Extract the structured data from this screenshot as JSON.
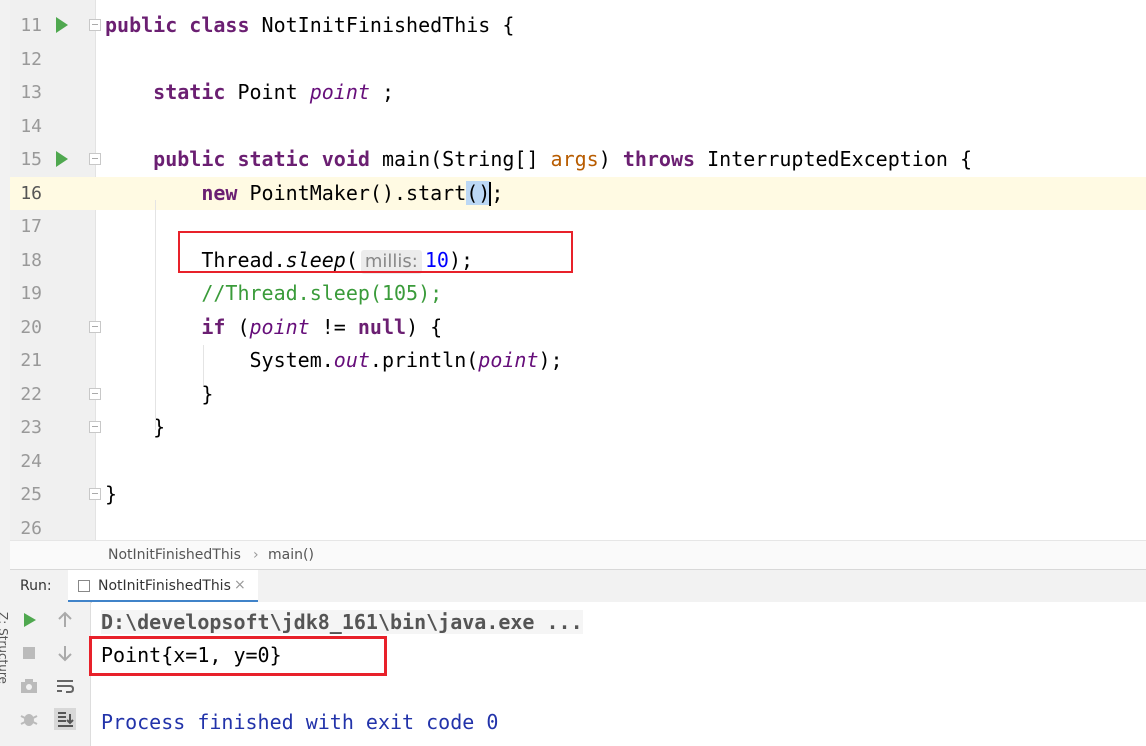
{
  "editor": {
    "lines": [
      {
        "num": "11",
        "code": [
          {
            "t": "public ",
            "c": "kwp"
          },
          {
            "t": "class ",
            "c": "kwp"
          },
          {
            "t": "NotInitFinishedThis {",
            "c": ""
          }
        ]
      },
      {
        "num": "12",
        "code": []
      },
      {
        "num": "13",
        "code": [
          {
            "t": "    static ",
            "c": "kwp"
          },
          {
            "t": "Point ",
            "c": ""
          },
          {
            "t": "point",
            "c": "field"
          },
          {
            "t": " ;",
            "c": ""
          }
        ]
      },
      {
        "num": "14",
        "code": []
      },
      {
        "num": "15",
        "code": [
          {
            "t": "    public ",
            "c": "kwp"
          },
          {
            "t": "static ",
            "c": "kwp"
          },
          {
            "t": "void ",
            "c": "kwp"
          },
          {
            "t": "main(String[] ",
            "c": ""
          },
          {
            "t": "args",
            "c": "param"
          },
          {
            "t": ") ",
            "c": ""
          },
          {
            "t": "throws ",
            "c": "kwp"
          },
          {
            "t": "InterruptedException {",
            "c": ""
          }
        ]
      },
      {
        "num": "16",
        "code": [
          {
            "t": "        new ",
            "c": "kwp"
          },
          {
            "t": "PointMaker().start",
            "c": ""
          },
          {
            "t": "()",
            "c": "brace-hl"
          },
          {
            "t": ";",
            "c": ""
          }
        ]
      },
      {
        "num": "17",
        "code": []
      },
      {
        "num": "18",
        "code": [
          {
            "t": "        Thread.",
            "c": ""
          },
          {
            "t": "sleep",
            "c": "static-m"
          },
          {
            "t": "(",
            "c": ""
          },
          {
            "t": "millis:",
            "c": "hint"
          },
          {
            "t": "10",
            "c": "num"
          },
          {
            "t": ");",
            "c": ""
          }
        ]
      },
      {
        "num": "19",
        "code": [
          {
            "t": "        //Thread.sleep(105);",
            "c": "comment"
          }
        ]
      },
      {
        "num": "20",
        "code": [
          {
            "t": "        if ",
            "c": "kwp"
          },
          {
            "t": "(",
            "c": ""
          },
          {
            "t": "point",
            "c": "field"
          },
          {
            "t": " != ",
            "c": ""
          },
          {
            "t": "null",
            "c": "kwp"
          },
          {
            "t": ") {",
            "c": ""
          }
        ]
      },
      {
        "num": "21",
        "code": [
          {
            "t": "            System.",
            "c": ""
          },
          {
            "t": "out",
            "c": "field"
          },
          {
            "t": ".println(",
            "c": ""
          },
          {
            "t": "point",
            "c": "field"
          },
          {
            "t": ");",
            "c": ""
          }
        ]
      },
      {
        "num": "22",
        "code": [
          {
            "t": "        }",
            "c": ""
          }
        ]
      },
      {
        "num": "23",
        "code": [
          {
            "t": "    }",
            "c": ""
          }
        ]
      },
      {
        "num": "24",
        "code": []
      },
      {
        "num": "25",
        "code": [
          {
            "t": "}",
            "c": ""
          }
        ]
      },
      {
        "num": "26",
        "code": []
      }
    ]
  },
  "breadcrumb": {
    "class": "NotInitFinishedThis",
    "sep": "›",
    "method": "main()"
  },
  "run_panel": {
    "label": "Run:",
    "tab_title": "NotInitFinishedThis",
    "tab_close": "×",
    "side_label": "Z: Structure",
    "console": {
      "command": "D:\\developsoft\\jdk8_161\\bin\\java.exe ...",
      "output": "Point{x=1, y=0}",
      "exit": "Process finished with exit code 0"
    }
  },
  "icons": [
    "run-icon",
    "fold-icon",
    "rerun-icon",
    "stop-icon",
    "camera-icon",
    "debug-icon",
    "arrow-up-icon",
    "arrow-down-icon",
    "soft-wrap-icon",
    "scroll-to-end-icon"
  ]
}
